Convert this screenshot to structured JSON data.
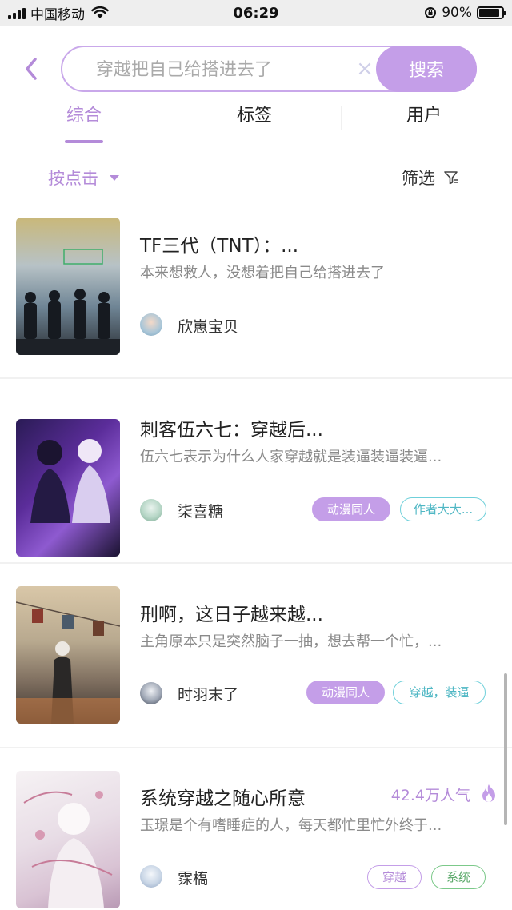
{
  "status_bar": {
    "carrier": "中国移动",
    "time": "06:29",
    "battery_percent": "90%",
    "battery_level": 0.9
  },
  "search": {
    "placeholder": "穿越把自己给搭进去了",
    "clear_symbol": "×",
    "button_label": "搜索"
  },
  "tabs": [
    {
      "label": "综合",
      "active": true
    },
    {
      "label": "标签",
      "active": false
    },
    {
      "label": "用户",
      "active": false
    }
  ],
  "sort": {
    "label": "按点击"
  },
  "filter": {
    "label": "筛选"
  },
  "books": [
    {
      "title": "TF三代（TNT）：...",
      "description": "本来想救人，没想着把自己给搭进去了",
      "author": "欣崽宝贝",
      "tags": []
    },
    {
      "title": "刺客伍六七：穿越后...",
      "description": "伍六七表示为什么人家穿越就是装逼装逼装逼...",
      "author": "柒喜糖",
      "tags": [
        "动漫同人",
        "作者大大..."
      ]
    },
    {
      "title": "刑啊，这日子越来越...",
      "description": "主角原本只是突然脑子一抽，想去帮一个忙，...",
      "author": "时羽末了",
      "tags": [
        "动漫同人",
        "穿越，装逼"
      ]
    },
    {
      "title": "系统穿越之随心所意",
      "description": "玉璟是个有嗜睡症的人，每天都忙里忙外终于...",
      "author": "霂槗",
      "popularity": "42.4万人气",
      "tags": [
        "穿越",
        "系统"
      ]
    }
  ],
  "icons": {
    "back": "chevron-left-icon",
    "filter": "filter-funnel-icon",
    "popularity": "flame-icon"
  },
  "colors": {
    "accent": "#b48bd9",
    "search_button": "#c49ee8",
    "tag_teal": "#6fd0da",
    "tag_green": "#7cc98a"
  }
}
